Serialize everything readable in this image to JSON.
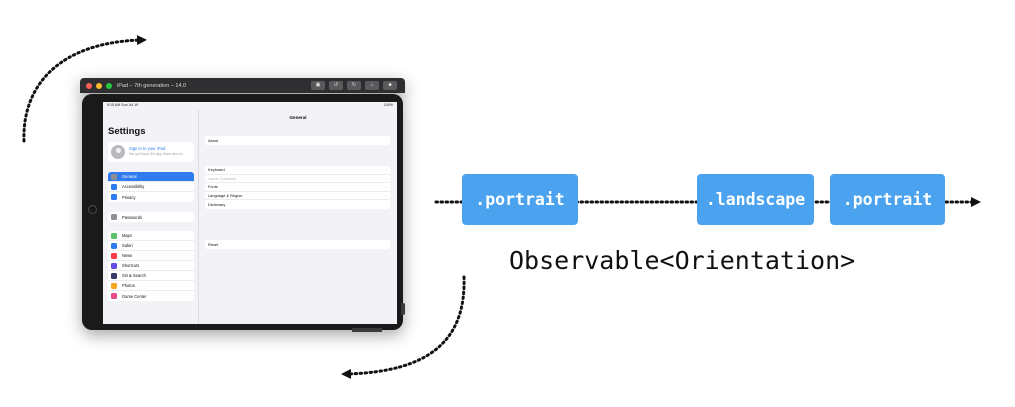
{
  "simulator": {
    "window_title": "iPad – 7th generation – 14.0",
    "traffic_lights": [
      "#ff5f57",
      "#febc2e",
      "#28c840"
    ],
    "toolbar_icons": [
      "screenshot-icon",
      "rotate-left-icon",
      "rotate-right-icon",
      "home-icon",
      "lock-icon"
    ],
    "status_bar": {
      "time": "9:15 AM  Sun Jul 19",
      "battery": "100%"
    },
    "sidebar": {
      "title": "Settings",
      "profile": {
        "name": "Sign in to your iPad",
        "subtitle": "Set up iCloud, the App Store, and m..."
      },
      "groups": [
        [
          {
            "label": "General",
            "icon": "gear-icon",
            "color": "#8e8e93",
            "selected": true
          },
          {
            "label": "Accessibility",
            "icon": "accessibility-icon",
            "color": "#2f7bf0",
            "selected": false
          },
          {
            "label": "Privacy",
            "icon": "hand-icon",
            "color": "#2f7bf0",
            "selected": false
          }
        ],
        [
          {
            "label": "Passwords",
            "icon": "key-icon",
            "color": "#8e8e93",
            "selected": false
          }
        ],
        [
          {
            "label": "Maps",
            "icon": "maps-icon",
            "color": "#5ac26a",
            "selected": false
          },
          {
            "label": "Safari",
            "icon": "safari-icon",
            "color": "#2f7bf0",
            "selected": false
          },
          {
            "label": "News",
            "icon": "news-icon",
            "color": "#ff3b47",
            "selected": false
          },
          {
            "label": "Shortcuts",
            "icon": "shortcuts-icon",
            "color": "#6a4de6",
            "selected": false
          },
          {
            "label": "Siri & Search",
            "icon": "siri-icon",
            "color": "#3b3b6b",
            "selected": false
          },
          {
            "label": "Photos",
            "icon": "photos-icon",
            "color": "#f5a623",
            "selected": false
          },
          {
            "label": "Game Center",
            "icon": "game-center-icon",
            "color": "#e84a8a",
            "selected": false
          }
        ]
      ]
    },
    "detail": {
      "title": "General",
      "groups": [
        [
          {
            "label": "About",
            "dim": false
          }
        ],
        [
          {
            "label": "Keyboard",
            "dim": false
          },
          {
            "label": "Game Controller",
            "dim": true
          },
          {
            "label": "Fonts",
            "dim": false
          },
          {
            "label": "Language & Region",
            "dim": false
          },
          {
            "label": "Dictionary",
            "dim": false
          }
        ],
        [
          {
            "label": "Reset",
            "dim": false
          }
        ]
      ]
    }
  },
  "timeline": {
    "events": [
      ".portrait",
      ".landscape",
      ".portrait"
    ],
    "label": "Observable<Orientation>",
    "event_color": "#4ba3f0"
  },
  "arrows": [
    "rotate-clockwise-arrow",
    "rotate-counterclockwise-arrow"
  ]
}
